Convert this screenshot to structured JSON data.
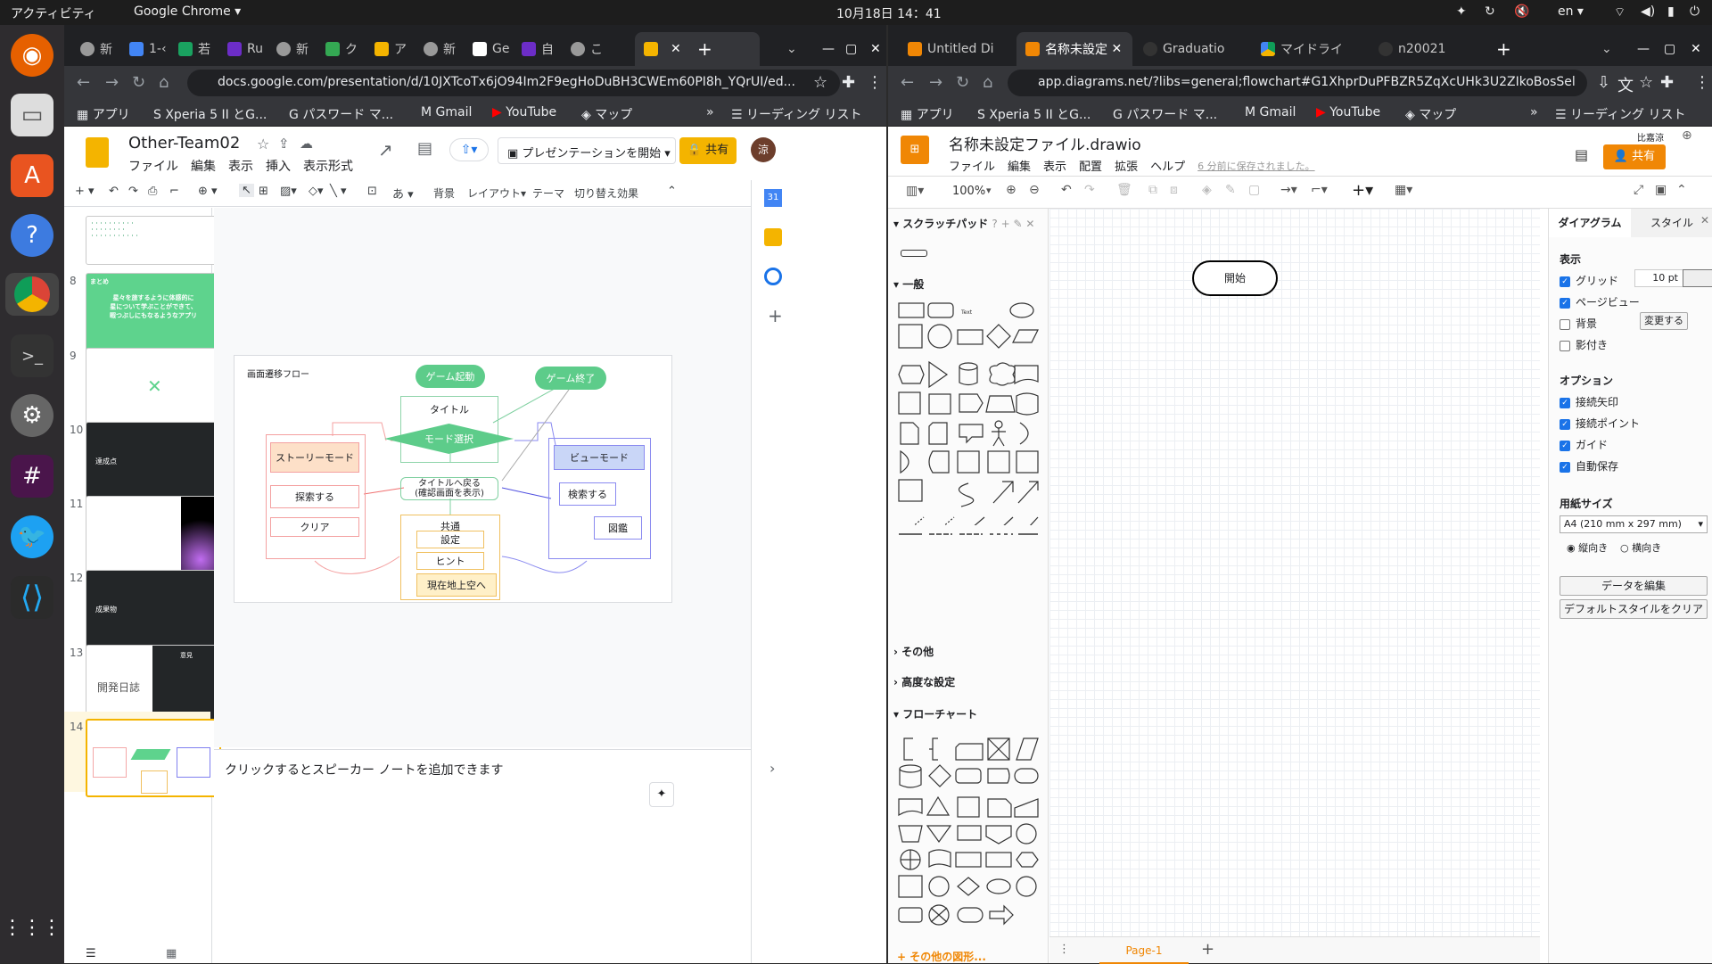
{
  "system": {
    "activities": "アクティビティ",
    "app": "Google Chrome ▾",
    "clock": "10月18日  14：41",
    "lang": "en ▾"
  },
  "left_window": {
    "tabs": [
      "新",
      "1-‹",
      "若",
      "Ru",
      "新",
      "ク",
      "ア",
      "新",
      "Ge",
      "自",
      "こ",
      ""
    ],
    "url": "docs.google.com/presentation/d/10JXTcoTx6jO94Im2F9egHoDuBH3CWEm60PI8h_YQrUI/ed...",
    "bookmarks": [
      "アプリ",
      "Xperia 5 II とG...",
      "パスワード マ...",
      "Gmail",
      "YouTube",
      "マップ"
    ],
    "reading_list": "リーディング リスト",
    "doc_title": "Other-Team02",
    "menus": [
      "ファイル",
      "編集",
      "表示",
      "挿入",
      "表示形式"
    ],
    "present": "プレゼンテーションを開始",
    "share": "共有",
    "avatar": "涼",
    "toolbar": [
      "背景",
      "レイアウト▾",
      "テーマ",
      "切り替え効果"
    ],
    "slide_numbers": [
      "8",
      "9",
      "10",
      "11",
      "12",
      "13",
      "14"
    ],
    "slide8": {
      "title": "まとめ",
      "line1": "星々を旅するように体感的に",
      "line2": "星について学ぶことができて、",
      "line3": "暇つぶしにもなるようなアプリ"
    },
    "slide10": "達成点",
    "slide12": "成果物",
    "slide13": {
      "title": "開発日誌",
      "right": "意見"
    },
    "diagram": {
      "title": "画面遷移フロー",
      "game_start": "ゲーム起動",
      "game_end": "ゲーム終了",
      "title_node": "タイトル",
      "mode_select": "モード選択",
      "story": "ストーリーモード",
      "explore": "探索する",
      "clear": "クリア",
      "back1": "タイトルへ戻る",
      "back2": "(確認画面を表示)",
      "view": "ビューモード",
      "search": "検索する",
      "zukan": "図鑑",
      "common": "共通",
      "settings": "設定",
      "hint": "ヒント",
      "sky": "現在地上空へ"
    },
    "notes": "クリックするとスピーカー ノートを追加できます"
  },
  "right_window": {
    "tabs": [
      "Untitled Di",
      "名称未設定",
      "Graduatio",
      "マイドライ",
      "n20021"
    ],
    "url": "app.diagrams.net/?libs=general;flowchart#G1XhprDuPFBZR5ZqXcUHk3U2ZIkoBosSel",
    "bookmarks": [
      "アプリ",
      "Xperia 5 II とG...",
      "パスワード マ...",
      "Gmail",
      "YouTube",
      "マップ"
    ],
    "reading_list": "リーディング リスト",
    "file_title": "名称未設定ファイル.drawio",
    "menus": [
      "ファイル",
      "編集",
      "表示",
      "配置",
      "拡張",
      "ヘルプ"
    ],
    "saved": "6 分前に保存されました。",
    "user": "比嘉涼",
    "share": "共有",
    "zoom": "100%",
    "scratchpad": "スクラッチパッド",
    "general": "一般",
    "other": "その他",
    "advanced": "高度な設定",
    "flowchart": "フローチャート",
    "more_shapes": "+ その他の図形...",
    "canvas_start": "開始",
    "page_tab": "Page-1",
    "panel": {
      "tab1": "ダイアグラム",
      "tab2": "スタイル",
      "view": "表示",
      "grid": "グリッド",
      "grid_size": "10 pt",
      "page_view": "ページビュー",
      "background": "背景",
      "change": "変更する",
      "shadow": "影付き",
      "options": "オプション",
      "conn_arrows": "接続矢印",
      "conn_points": "接続ポイント",
      "guides": "ガイド",
      "autosave": "自動保存",
      "paper": "用紙サイズ",
      "paper_value": "A4 (210 mm x 297 mm)",
      "portrait": "縦向き",
      "landscape": "横向き",
      "edit_data": "データを編集",
      "clear_style": "デフォルトスタイルをクリア"
    }
  },
  "colors": {
    "docs_yellow": "#f4b400",
    "drawio_orange": "#f08705",
    "green_node": "#5dcc8a",
    "blue_node": "#c9d6f7",
    "orange_node": "#fde0c8",
    "yellow_node": "#fff0c8"
  }
}
